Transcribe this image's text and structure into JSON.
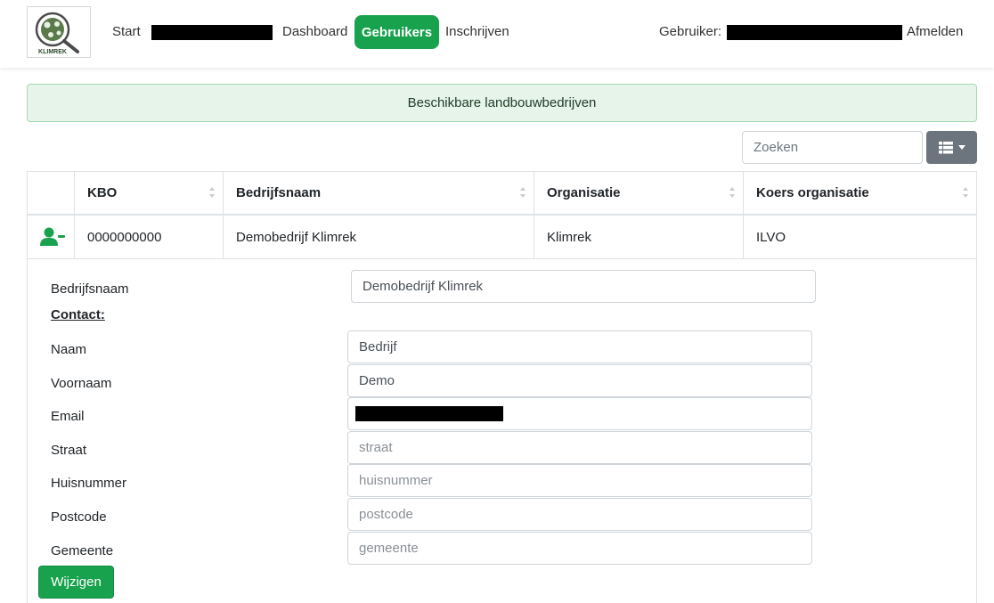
{
  "nav": {
    "start": "Start",
    "dashboard": "Dashboard",
    "users": "Gebruikers",
    "register": "Inschrijven",
    "user_label": "Gebruiker:",
    "logout": "Afmelden",
    "accent": "#19a24d"
  },
  "logo": {
    "text": "KLIMREK"
  },
  "banner": {
    "text": "Beschikbare landbouwbedrijven"
  },
  "search": {
    "placeholder": "Zoeken"
  },
  "toolbar": {
    "view_icon": "list-view-icon"
  },
  "table": {
    "columns": [
      "KBO",
      "Bedrijfsnaam",
      "Organisatie",
      "Koers organisatie"
    ],
    "rows": [
      {
        "icon": "user-minus-icon",
        "kbo": "0000000000",
        "name": "Demobedrijf Klimrek",
        "org": "Klimrek",
        "course": "ILVO"
      }
    ]
  },
  "detail": {
    "company_label": "Bedrijfsnaam",
    "company_value": "Demobedrijf Klimrek",
    "contact_heading": "Contact:",
    "fields": [
      {
        "label": "Naam",
        "value": "Bedrijf",
        "placeholder": ""
      },
      {
        "label": "Voornaam",
        "value": "Demo",
        "placeholder": ""
      },
      {
        "label": "Email",
        "value": "",
        "placeholder": ""
      },
      {
        "label": "Straat",
        "value": "",
        "placeholder": "straat"
      },
      {
        "label": "Huisnummer",
        "value": "",
        "placeholder": "huisnummer"
      },
      {
        "label": "Postcode",
        "value": "",
        "placeholder": "postcode"
      },
      {
        "label": "Gemeente",
        "value": "",
        "placeholder": "gemeente"
      }
    ],
    "submit_label": "Wijzigen"
  }
}
